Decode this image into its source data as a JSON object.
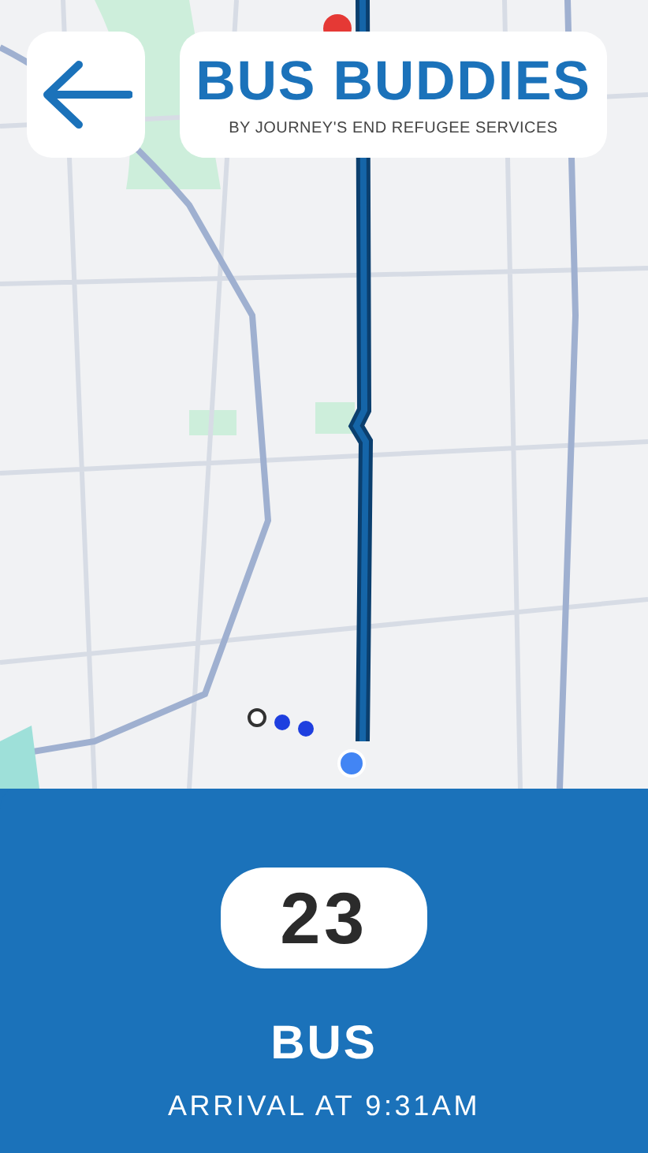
{
  "header": {
    "title": "BUS BUDDIES",
    "subtitle": "BY JOURNEY'S END REFUGEE SERVICES"
  },
  "arrival": {
    "route": "23",
    "mode": "BUS",
    "time": "ARRIVAL AT 9:31AM"
  }
}
